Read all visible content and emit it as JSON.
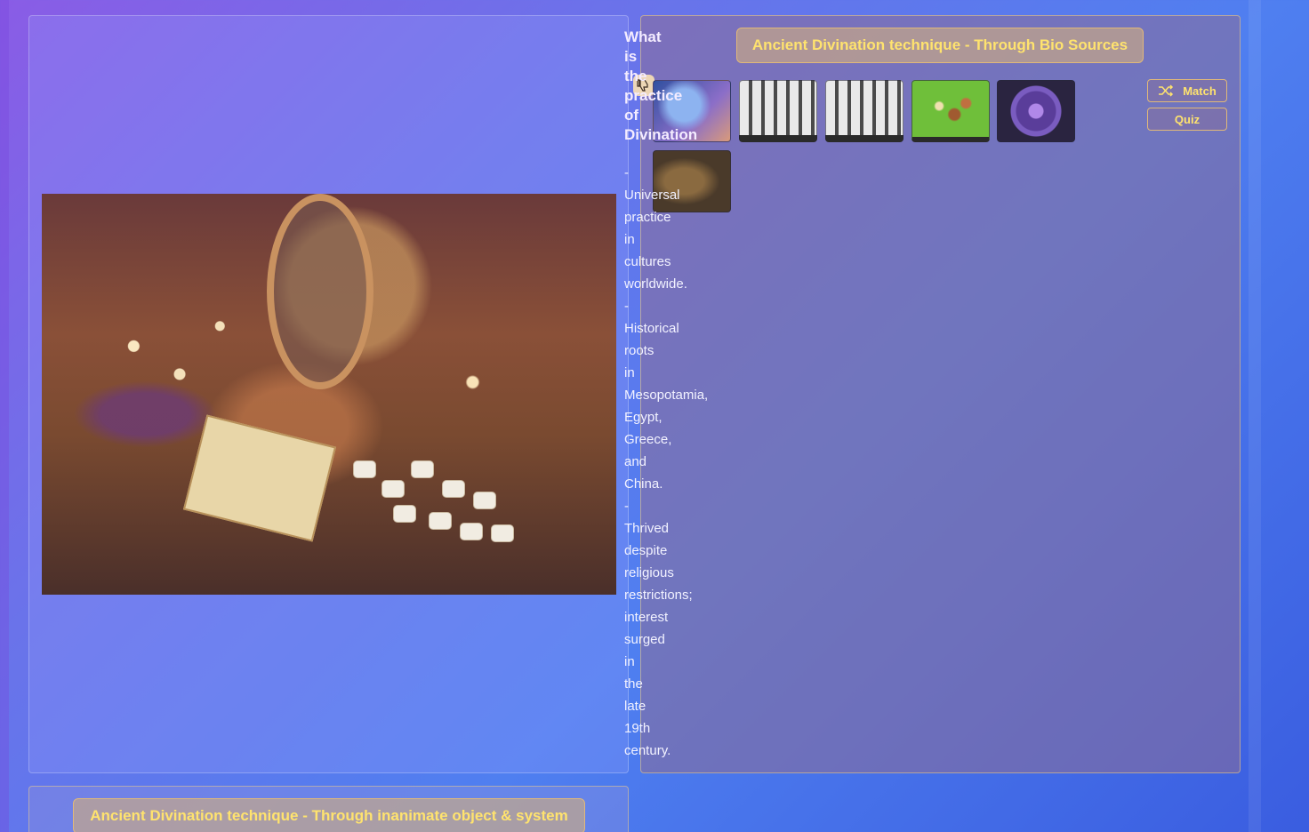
{
  "left_panel": {
    "question": "What is the practice of Divination",
    "bullets": [
      "- Universal practice in cultures worldwide.",
      "- Historical roots in Mesopotamia, Egypt, Greece, and China.",
      "- Thrived despite religious restrictions; interest surged in the late 19th century."
    ]
  },
  "right_panel": {
    "title": "Ancient Divination technique - Through Bio Sources",
    "buttons": {
      "match": "Match",
      "quiz": "Quiz"
    },
    "icons": {
      "match": "shuffle-icon",
      "feedback": "thumbs-down-icon"
    },
    "thumbnail_count": 6
  },
  "bottom_panel": {
    "title": "Ancient Divination technique - Through inanimate object & system"
  }
}
